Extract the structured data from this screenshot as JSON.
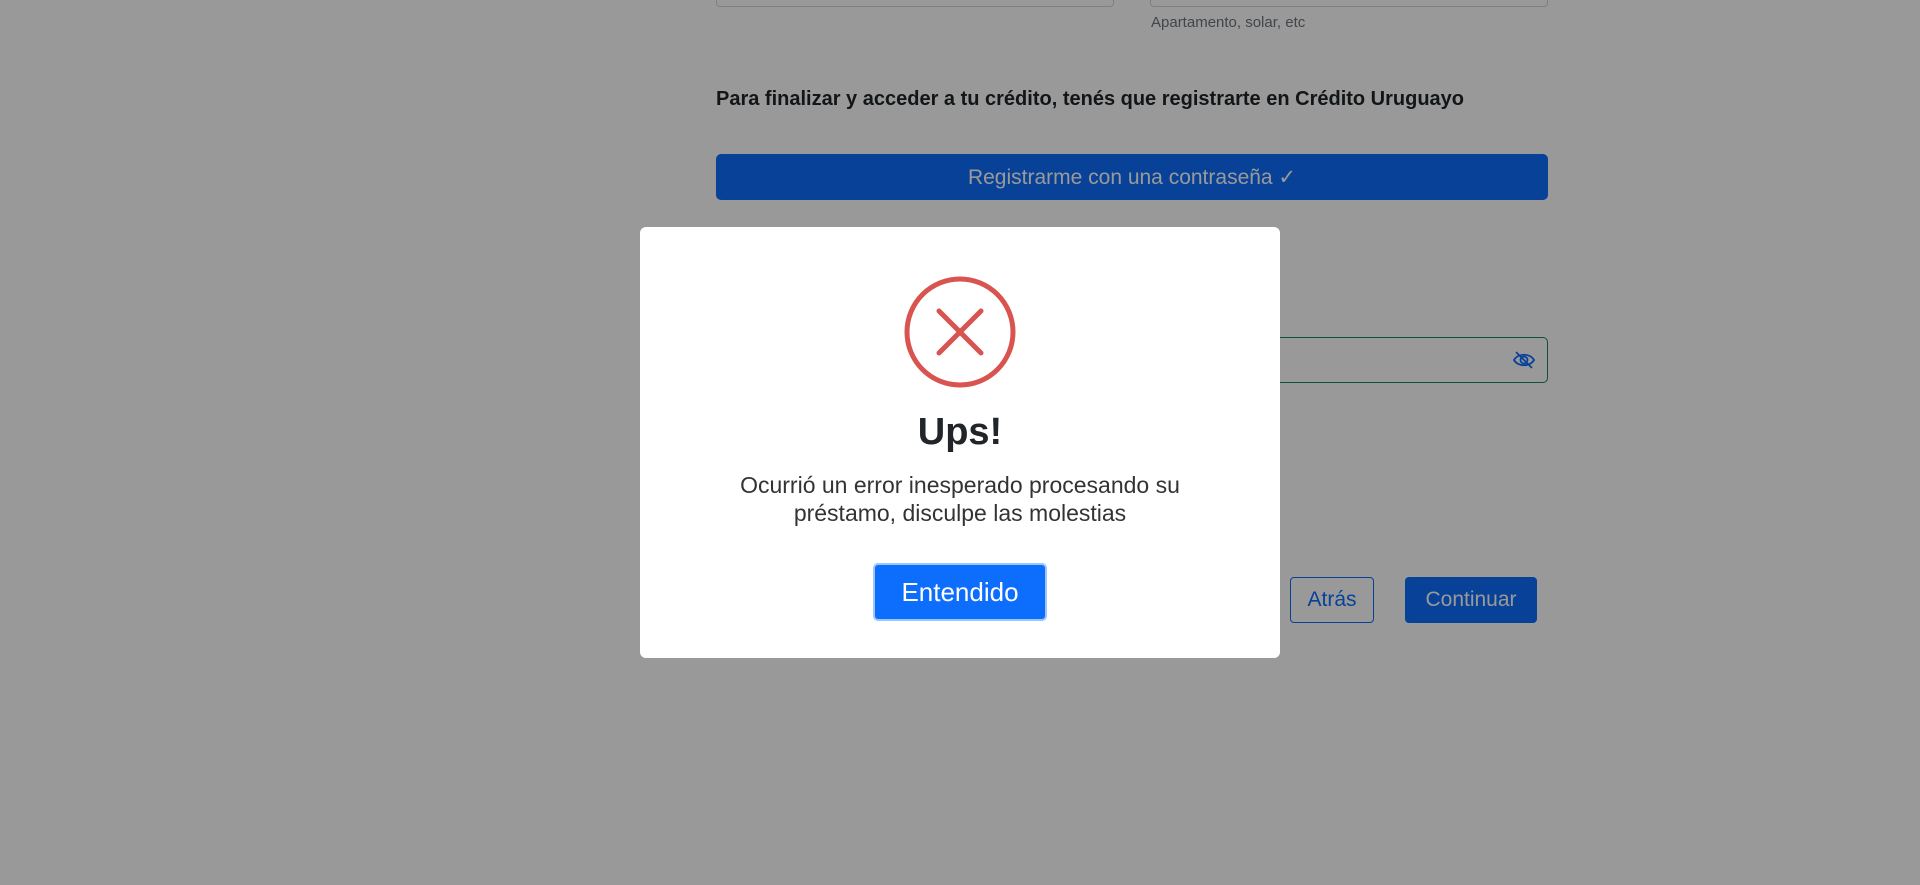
{
  "form": {
    "address_help": "Apartamento, solar, etc",
    "register_heading": "Para finalizar y acceder a tu crédito, tenés que registrarte en Crédito Uruguayo",
    "register_button": "Registrarme con una contraseña ✓",
    "back_button": "Atrás",
    "continue_button": "Continuar"
  },
  "dialog": {
    "icon": "error-x-icon",
    "title": "Ups!",
    "message": "Ocurrió un error inesperado procesando su préstamo, disculpe las molestias",
    "confirm_button": "Entendido"
  },
  "colors": {
    "primary": "#0d6efd",
    "error": "#d9534f",
    "success_border": "#198754",
    "overlay": "rgba(0,0,0,0.4)"
  }
}
